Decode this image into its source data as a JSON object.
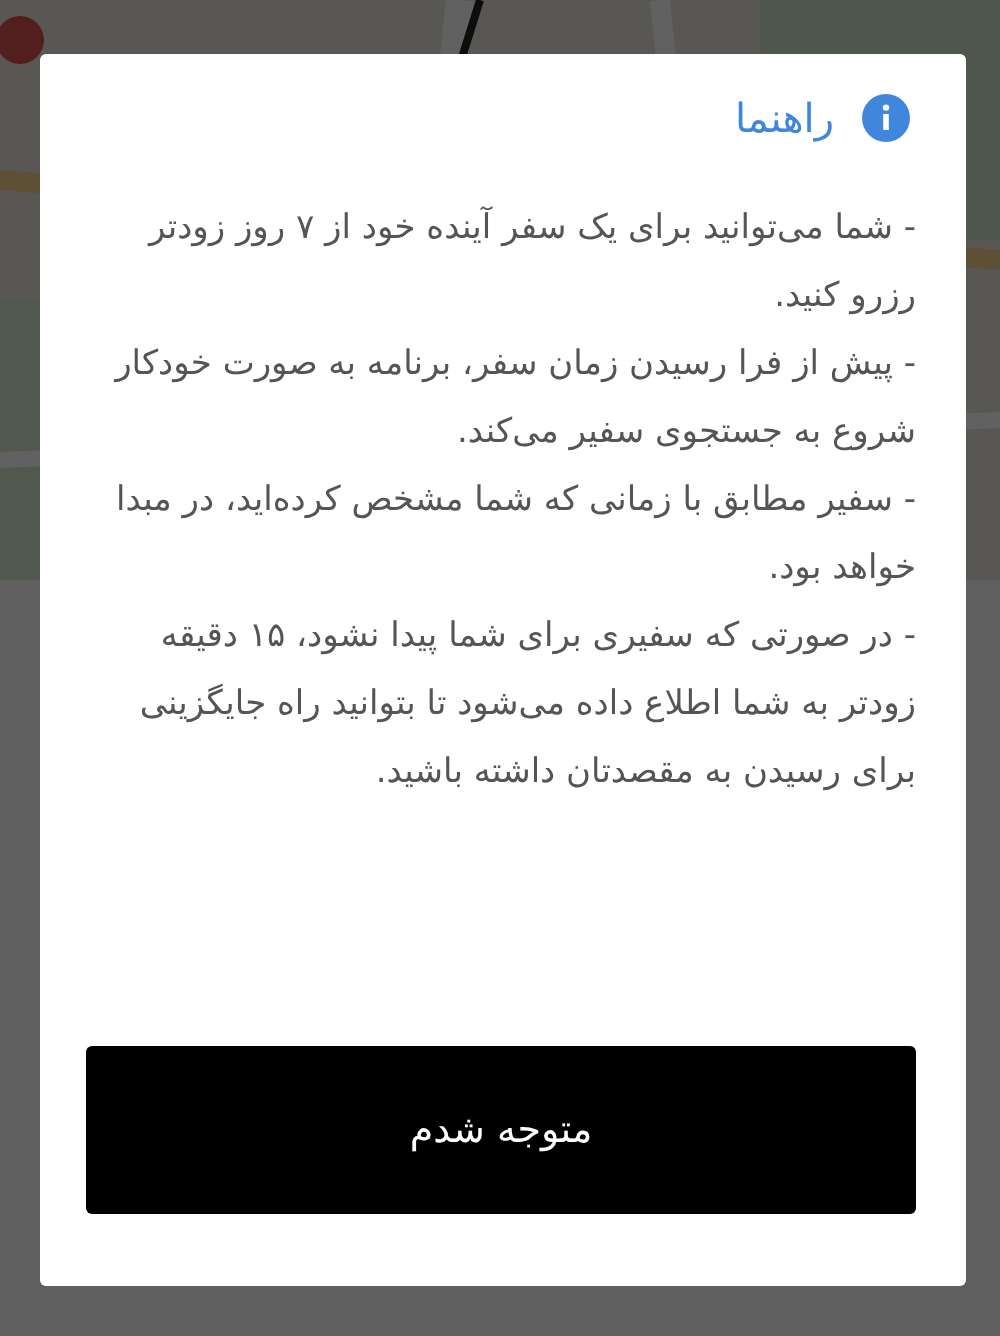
{
  "dialog": {
    "title": "راهنما",
    "paragraphs": [
      "- شما می‌توانید برای یک سفر آینده خود از ۷ روز زودتر رزرو کنید.",
      "- پیش از فرا رسیدن زمان سفر، برنامه به صورت خودکار شروع به جستجوی سفیر می‌کند.",
      "- سفیر مطابق با زمانی که شما مشخص کرده‌اید، در مبدا خواهد بود.",
      "- در صورتی که سفیری برای شما پیدا نشود، ۱۵ دقیقه زودتر به شما اطلاع داده می‌شود تا بتوانید راه جایگزینی برای رسیدن به مقصدتان داشته باشید."
    ],
    "button": "متوجه شدم"
  }
}
